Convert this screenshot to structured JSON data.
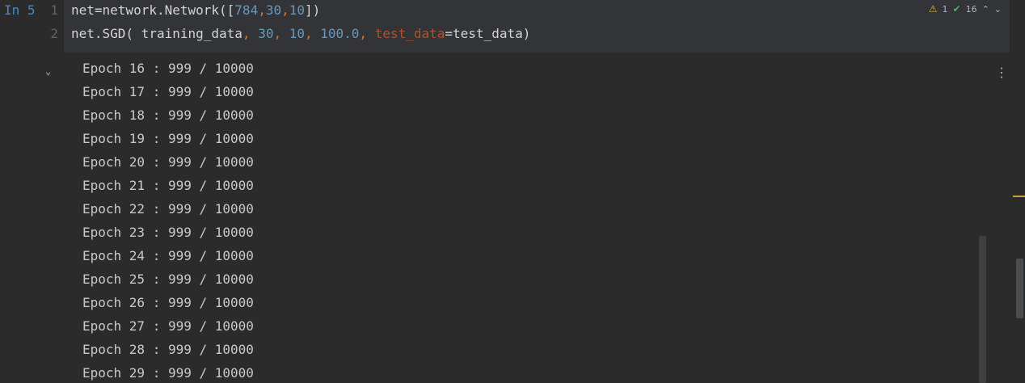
{
  "cell": {
    "label": "In 5",
    "line_numbers": [
      "1",
      "2"
    ],
    "code_line1": {
      "t1": "net=network.Network([",
      "n1": "784",
      "s1": ",",
      "n2": "30",
      "s2": ",",
      "n3": "10",
      "t2": "])"
    },
    "code_line2": {
      "t1": "net.SGD( training_data",
      "c1": ", ",
      "n1": "30",
      "c2": ", ",
      "n2": "10",
      "c3": ", ",
      "n3": "100.0",
      "c4": ", ",
      "p1": "test_data",
      "t2": "=test_data)"
    }
  },
  "inspections": {
    "warnings": "1",
    "ok": "16",
    "warning_icon": "warning-triangle-icon",
    "ok_icon": "check-icon"
  },
  "output": {
    "lines": [
      "Epoch 16 : 999 / 10000",
      "Epoch 17 : 999 / 10000",
      "Epoch 18 : 999 / 10000",
      "Epoch 19 : 999 / 10000",
      "Epoch 20 : 999 / 10000",
      "Epoch 21 : 999 / 10000",
      "Epoch 22 : 999 / 10000",
      "Epoch 23 : 999 / 10000",
      "Epoch 24 : 999 / 10000",
      "Epoch 25 : 999 / 10000",
      "Epoch 26 : 999 / 10000",
      "Epoch 27 : 999 / 10000",
      "Epoch 28 : 999 / 10000",
      "Epoch 29 : 999 / 10000"
    ]
  },
  "colors": {
    "background": "#2b2b2b",
    "cell_background": "#323438",
    "number": "#6897bb",
    "keyword_separator": "#cc7832",
    "warning": "#e0b13f",
    "ok": "#59a869"
  }
}
